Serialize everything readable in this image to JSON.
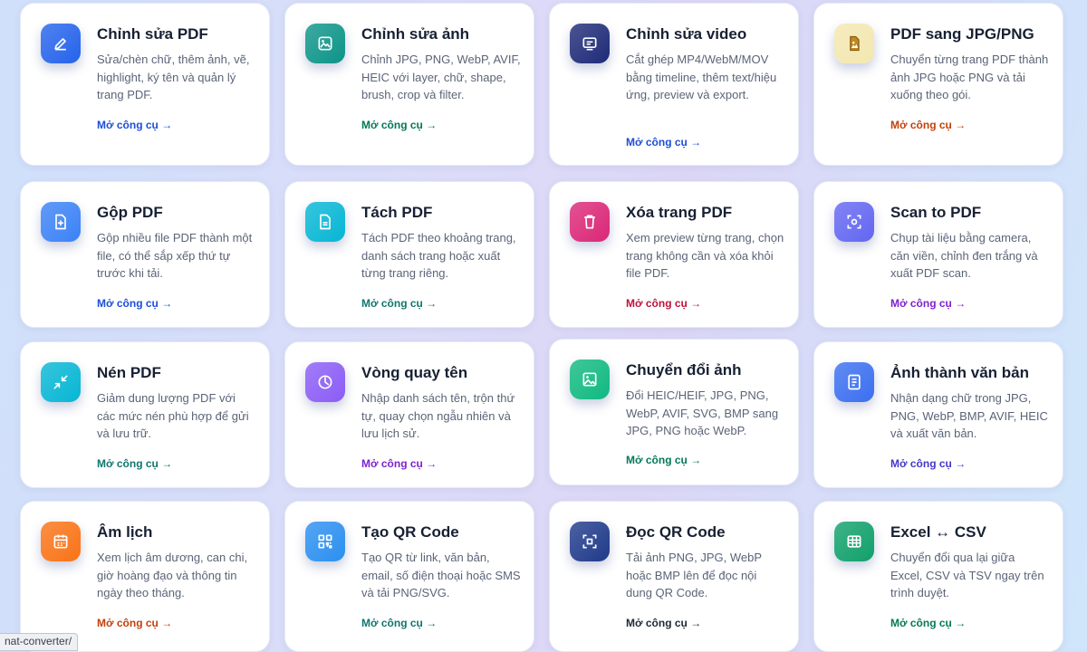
{
  "cards": [
    {
      "name": "chinh-sua-pdf",
      "icon": "pencil-icon",
      "title": "Chỉnh sửa PDF",
      "desc": "Sửa/chèn chữ, thêm ảnh, vẽ, highlight, ký tên và quản lý trang PDF.",
      "link": "Mở công cụ →",
      "color": "#2563eb",
      "link_color": "#1d4ed8"
    },
    {
      "name": "chinh-sua-anh",
      "icon": "image-edit-icon",
      "title": "Chỉnh sửa ảnh",
      "desc": "Chỉnh JPG, PNG, WebP, AVIF, HEIC với layer, chữ, shape, brush, crop và filter.",
      "link": "Mở công cụ →",
      "color": "#0d9488",
      "link_color": "#047857"
    },
    {
      "name": "chinh-sua-video",
      "icon": "video-editor-icon",
      "title": "Chỉnh sửa video",
      "desc": "Cắt ghép MP4/WebM/MOV bằng timeline, thêm text/hiệu ứng, preview và export.",
      "link": "Mở công cụ →",
      "color": "#1e2a78",
      "link_color": "#1d4ed8"
    },
    {
      "name": "pdf-sang-jpg-png",
      "icon": "pdf-image-icon",
      "title": "PDF sang JPG/PNG",
      "desc": "Chuyển từng trang PDF thành ảnh JPG hoặc PNG và tải xuống theo gói.",
      "link": "Mở công cụ →",
      "color": "#f3e7b0",
      "link_color": "#c2410c"
    },
    {
      "name": "gop-pdf",
      "icon": "merge-file-icon",
      "title": "Gộp PDF",
      "desc": "Gộp nhiều file PDF thành một file, có thể sắp xếp thứ tự trước khi tải.",
      "link": "Mở công cụ →",
      "color": "#3b82f6",
      "link_color": "#1d4ed8"
    },
    {
      "name": "tach-pdf",
      "icon": "document-icon",
      "title": "Tách PDF",
      "desc": "Tách PDF theo khoảng trang, danh sách trang hoặc xuất từng trang riêng.",
      "link": "Mở công cụ →",
      "color": "#06b6d4",
      "link_color": "#0f766e"
    },
    {
      "name": "xoa-trang-pdf",
      "icon": "trash-icon",
      "title": "Xóa trang PDF",
      "desc": "Xem preview từng trang, chọn trang không cần và xóa khỏi file PDF.",
      "link": "Mở công cụ →",
      "color": "#db2777",
      "link_color": "#be123c"
    },
    {
      "name": "scan-to-pdf",
      "icon": "scan-icon",
      "title": "Scan to PDF",
      "desc": "Chụp tài liệu bằng camera, căn viền, chỉnh đen trắng và xuất PDF scan.",
      "link": "Mở công cụ →",
      "color": "#6366f1",
      "link_color": "#7e22ce"
    },
    {
      "name": "nen-pdf",
      "icon": "compress-icon",
      "title": "Nén PDF",
      "desc": "Giảm dung lượng PDF với các mức nén phù hợp để gửi và lưu trữ.",
      "link": "Mở công cụ →",
      "color": "#06b6d4",
      "link_color": "#0f766e"
    },
    {
      "name": "vong-quay-ten",
      "icon": "wheel-icon",
      "title": "Vòng quay tên",
      "desc": "Nhập danh sách tên, trộn thứ tự, quay chọn ngẫu nhiên và lưu lịch sử.",
      "link": "Mở công cụ →",
      "color": "#8b5cf6",
      "link_color": "#7e22ce"
    },
    {
      "name": "chuyen-doi-anh",
      "icon": "image-icon",
      "title": "Chuyển đổi ảnh",
      "desc": "Đổi HEIC/HEIF, JPG, PNG, WebP, AVIF, SVG, BMP sang JPG, PNG hoặc WebP.",
      "link": "Mở công cụ →",
      "color": "#10b981",
      "link_color": "#047857"
    },
    {
      "name": "anh-thanh-van-ban",
      "icon": "text-document-icon",
      "title": "Ảnh thành văn bản",
      "desc": "Nhận dạng chữ trong JPG, PNG, WebP, BMP, AVIF, HEIC và xuất văn bản.",
      "link": "Mở công cụ →",
      "color": "#3b6ff0",
      "link_color": "#4338ca"
    },
    {
      "name": "am-lich",
      "icon": "calendar-icon",
      "title": "Âm lịch",
      "desc": "Xem lịch âm dương, can chi, giờ hoàng đạo và thông tin ngày theo tháng.",
      "link": "Mở công cụ →",
      "color": "#f97316",
      "link_color": "#c2410c"
    },
    {
      "name": "tao-qr-code",
      "icon": "qr-grid-icon",
      "title": "Tạo QR Code",
      "desc": "Tạo QR từ link, văn bản, email, số điện thoại hoặc SMS và tải PNG/SVG.",
      "link": "Mở công cụ →",
      "color": "#2b8ff0",
      "link_color": "#0f766e"
    },
    {
      "name": "doc-qr-code",
      "icon": "qr-scan-icon",
      "title": "Đọc QR Code",
      "desc": "Tải ảnh PNG, JPG, WebP hoặc BMP lên để đọc nội dung QR Code.",
      "link": "Mở công cụ →",
      "color": "#1f3a8a",
      "link_color": "#1f2937"
    },
    {
      "name": "excel-csv",
      "icon": "table-icon",
      "title": "Excel ↔ CSV",
      "desc": "Chuyển đổi qua lại giữa Excel, CSV và TSV ngay trên trình duyệt.",
      "link": "Mở công cụ →",
      "color": "#10a06a",
      "link_color": "#047857"
    }
  ],
  "status_bar": "nat-converter/"
}
